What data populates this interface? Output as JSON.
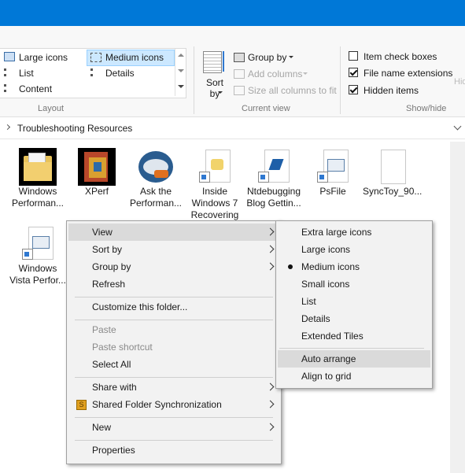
{
  "ribbon": {
    "layout": {
      "items": [
        "Large icons",
        "Medium icons",
        "List",
        "Details",
        "Content"
      ],
      "group_label": "Layout"
    },
    "current_view": {
      "sort_by": "Sort by",
      "group_by": "Group by",
      "add_columns": "Add columns",
      "size_columns": "Size all columns to fit",
      "group_label": "Current view"
    },
    "show_hide": {
      "item_check_boxes": {
        "label": "Item check boxes",
        "checked": false
      },
      "file_name_extensions": {
        "label": "File name extensions",
        "checked": true
      },
      "hidden_items": {
        "label": "Hidden items",
        "checked": true
      },
      "group_label": "Show/hide",
      "partial_label": "Hid"
    }
  },
  "address_bar": {
    "path": "Troubleshooting Resources"
  },
  "files": [
    {
      "line1": "Windows",
      "line2": "Performan...",
      "icon": "folder-icon"
    },
    {
      "line1": "XPerf",
      "line2": "",
      "icon": "book-icon"
    },
    {
      "line1": "Ask the",
      "line2": "Performan...",
      "icon": "blog-icon"
    },
    {
      "line1": "Inside",
      "line2": "Windows 7",
      "line3": "Recovering",
      "icon": "shortcut-icon"
    },
    {
      "line1": "Ntdebugging",
      "line2": "Blog  Gettin...",
      "icon": "shortcut-icon"
    },
    {
      "line1": "PsFile",
      "line2": "",
      "icon": "shortcut-icon"
    },
    {
      "line1": "SyncToy_90...",
      "line2": "",
      "icon": "file-icon"
    },
    {
      "line1": "Windows",
      "line2": "Vista Perfor...",
      "icon": "shortcut-icon"
    }
  ],
  "context_menu": {
    "view": "View",
    "sort_by": "Sort by",
    "group_by": "Group by",
    "refresh": "Refresh",
    "customize": "Customize this folder...",
    "paste": "Paste",
    "paste_shortcut": "Paste shortcut",
    "select_all": "Select All",
    "share_with": "Share with",
    "shared_sync": "Shared Folder Synchronization",
    "new": "New",
    "properties": "Properties"
  },
  "view_submenu": {
    "extra_large": "Extra large icons",
    "large": "Large icons",
    "medium": "Medium icons",
    "small": "Small icons",
    "list": "List",
    "details": "Details",
    "extended_tiles": "Extended Tiles",
    "auto_arrange": "Auto arrange",
    "align_to_grid": "Align to grid",
    "selected": "Medium icons"
  },
  "colors": {
    "titlebar": "#0078d7",
    "selection": "#cce8ff",
    "menu_bg": "#f2f2f2"
  }
}
